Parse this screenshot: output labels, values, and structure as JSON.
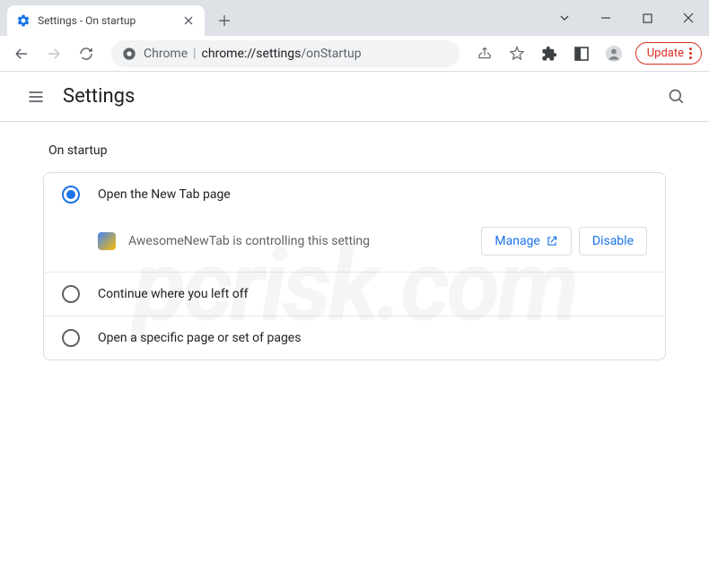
{
  "tab": {
    "title": "Settings - On startup"
  },
  "addr": {
    "scheme": "Chrome",
    "host": "chrome://settings",
    "path": "/onStartup"
  },
  "update": {
    "label": "Update"
  },
  "settings": {
    "title": "Settings"
  },
  "section": {
    "title": "On startup"
  },
  "options": [
    {
      "label": "Open the New Tab page",
      "selected": true
    },
    {
      "label": "Continue where you left off",
      "selected": false
    },
    {
      "label": "Open a specific page or set of pages",
      "selected": false
    }
  ],
  "extension": {
    "notice": "AwesomeNewTab is controlling this setting",
    "manage": "Manage",
    "disable": "Disable"
  },
  "watermark": "pcrisk.com"
}
